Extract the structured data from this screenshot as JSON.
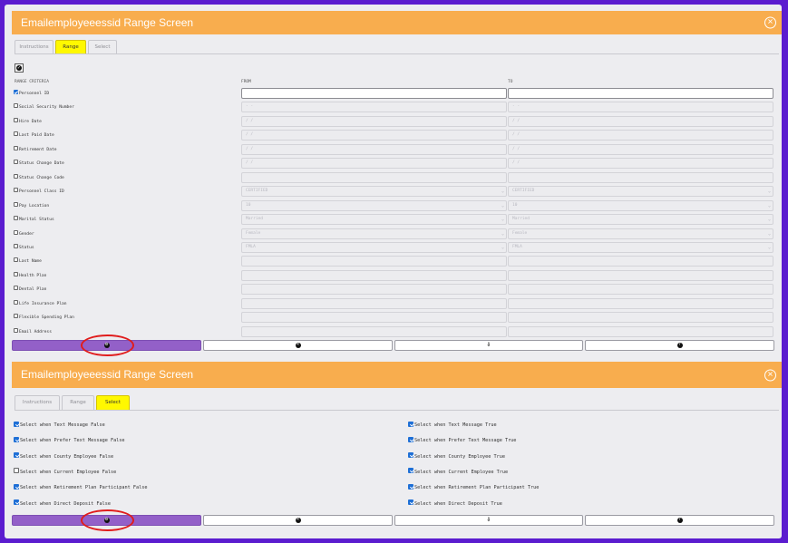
{
  "range_panel": {
    "title": "Emailemployeeessid Range Screen",
    "tabs": [
      {
        "label": "Instructions",
        "active": false
      },
      {
        "label": "Range",
        "active": true
      },
      {
        "label": "Select",
        "active": false
      }
    ],
    "headers": {
      "criteria": "RANGE CRITERIA",
      "from": "FROM",
      "to": "TO"
    },
    "rows": [
      {
        "label": "Personnel ID",
        "checked": true,
        "from": "",
        "to": "",
        "select": false
      },
      {
        "label": "Social Security Number",
        "checked": false,
        "from": "  -  -",
        "to": "  -  -",
        "select": false
      },
      {
        "label": "Hire Date",
        "checked": false,
        "from": "  /  /",
        "to": "  /  /",
        "select": false
      },
      {
        "label": "Last Paid Date",
        "checked": false,
        "from": "  /  /",
        "to": "  /  /",
        "select": false
      },
      {
        "label": "Retirement Date",
        "checked": false,
        "from": "  /  /",
        "to": "  /  /",
        "select": false
      },
      {
        "label": "Status Change Date",
        "checked": false,
        "from": "  /  /",
        "to": "  /  /",
        "select": false
      },
      {
        "label": "Status Change Code",
        "checked": false,
        "from": "",
        "to": "",
        "select": false
      },
      {
        "label": "Personnel Class ID",
        "checked": false,
        "from": "CERTIFIED",
        "to": "CERTIFIED",
        "select": true
      },
      {
        "label": "Pay Location",
        "checked": false,
        "from": "10",
        "to": "10",
        "select": true
      },
      {
        "label": "Marital Status",
        "checked": false,
        "from": "Married",
        "to": "Married",
        "select": true
      },
      {
        "label": "Gender",
        "checked": false,
        "from": "Female",
        "to": "Female",
        "select": true
      },
      {
        "label": "Status",
        "checked": false,
        "from": "FMLA",
        "to": "FMLA",
        "select": true
      },
      {
        "label": "Last Name",
        "checked": false,
        "from": "",
        "to": "",
        "select": false
      },
      {
        "label": "Health Plan",
        "checked": false,
        "from": "",
        "to": "",
        "select": false
      },
      {
        "label": "Dental Plan",
        "checked": false,
        "from": "",
        "to": "",
        "select": false
      },
      {
        "label": "Life Insurance Plan",
        "checked": false,
        "from": "",
        "to": "",
        "select": false
      },
      {
        "label": "Flexible Spending Plan",
        "checked": false,
        "from": "",
        "to": "",
        "select": false
      },
      {
        "label": "Email Address",
        "checked": false,
        "from": "",
        "to": "",
        "select": false
      }
    ]
  },
  "select_panel": {
    "title": "Emailemployeeessid Range Screen",
    "tabs": [
      {
        "label": "Instructions",
        "active": false
      },
      {
        "label": "Range",
        "active": false
      },
      {
        "label": "Select",
        "active": true
      }
    ],
    "left": [
      {
        "label": "Select when Text Message False",
        "checked": true
      },
      {
        "label": "Select when Prefer Text Message False",
        "checked": true
      },
      {
        "label": "Select when County Employee False",
        "checked": true
      },
      {
        "label": "Select when Current Employee False",
        "checked": false
      },
      {
        "label": "Select when Retirement Plan Participant False",
        "checked": true
      },
      {
        "label": "Select when Direct Deposit False",
        "checked": true
      }
    ],
    "right": [
      {
        "label": "Select when Text Message True",
        "checked": true
      },
      {
        "label": "Select when Prefer Text Message True",
        "checked": true
      },
      {
        "label": "Select when County Employee True",
        "checked": true
      },
      {
        "label": "Select when Current Employee True",
        "checked": true
      },
      {
        "label": "Select when Retirement Plan Participant True",
        "checked": true
      },
      {
        "label": "Select when Direct Deposit True",
        "checked": true
      }
    ]
  },
  "buttons": [
    {
      "icon": "gear-icon",
      "glyph": "⚙",
      "style": "primary"
    },
    {
      "icon": "close-circle-icon",
      "glyph": "✕",
      "style": "default"
    },
    {
      "icon": "download-icon",
      "glyph": "⇩",
      "style": "default"
    },
    {
      "icon": "help-icon",
      "glyph": "?",
      "style": "default"
    }
  ],
  "colors": {
    "title_bar": "#f8ad4e",
    "active_tab": "#fff800",
    "primary_button": "#9360c8",
    "highlight_ring": "#e01c1c",
    "border": "#5b1ccf"
  }
}
